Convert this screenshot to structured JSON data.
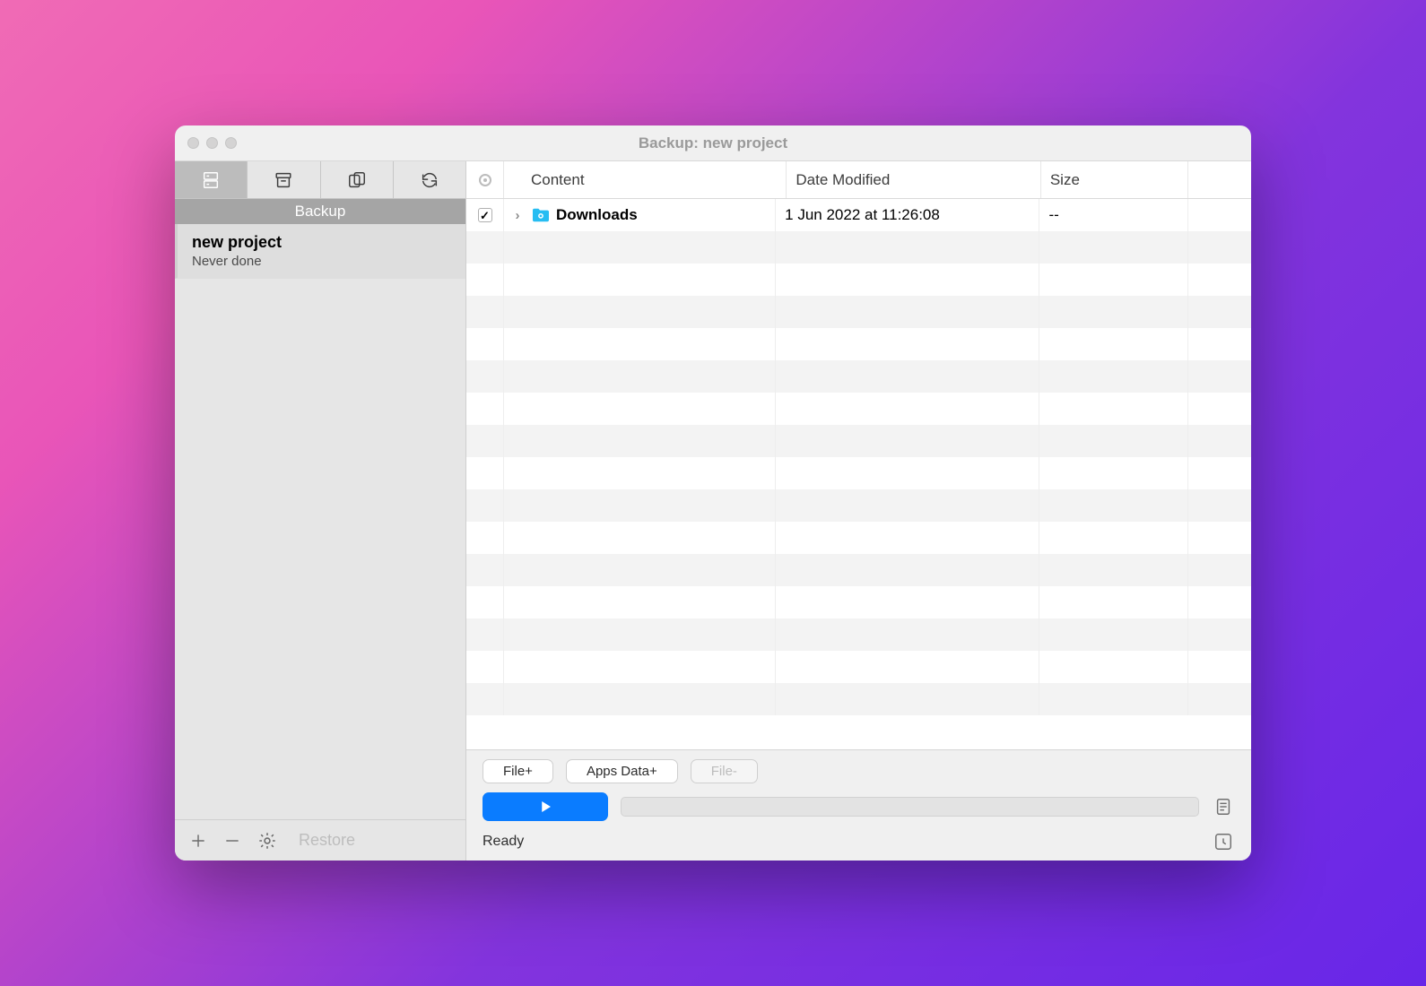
{
  "window": {
    "title": "Backup: new project"
  },
  "sidebar": {
    "section_label": "Backup",
    "projects": [
      {
        "name": "new project",
        "status": "Never done"
      }
    ],
    "restore_label": "Restore"
  },
  "table": {
    "headers": {
      "content": "Content",
      "date": "Date Modified",
      "size": "Size"
    },
    "rows": [
      {
        "checked": true,
        "name": "Downloads",
        "date": "1 Jun 2022 at 11:26:08",
        "size": "--"
      }
    ]
  },
  "footer": {
    "file_add": "File+",
    "apps_data_add": "Apps Data+",
    "file_remove": "File-",
    "status": "Ready"
  }
}
